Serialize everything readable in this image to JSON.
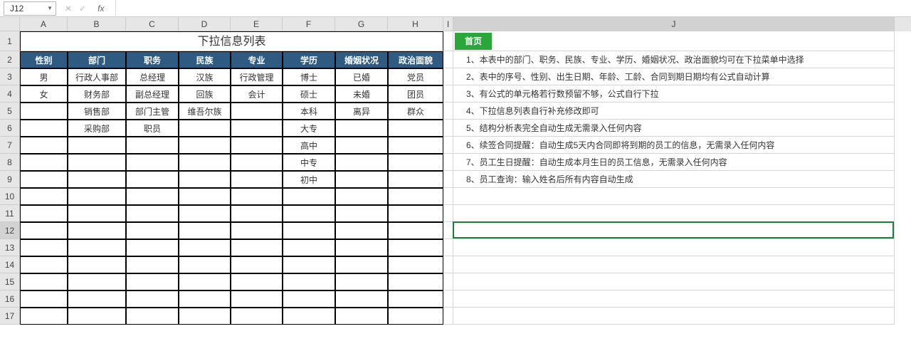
{
  "nameBox": "J12",
  "formula": "",
  "columns": [
    "A",
    "B",
    "C",
    "D",
    "E",
    "F",
    "G",
    "H",
    "I",
    "J"
  ],
  "rowCount": 17,
  "activeCell": {
    "col": "J",
    "row": 12
  },
  "table": {
    "title": "下拉信息列表",
    "headers": [
      "性别",
      "部门",
      "职务",
      "民族",
      "专业",
      "学历",
      "婚姻状况",
      "政治面貌"
    ],
    "rows": [
      [
        "男",
        "行政人事部",
        "总经理",
        "汉族",
        "行政管理",
        "博士",
        "已婚",
        "党员"
      ],
      [
        "女",
        "财务部",
        "副总经理",
        "回族",
        "会计",
        "硕士",
        "未婚",
        "团员"
      ],
      [
        "",
        "销售部",
        "部门主管",
        "维吾尔族",
        "",
        "本科",
        "离异",
        "群众"
      ],
      [
        "",
        "采购部",
        "职员",
        "",
        "",
        "大专",
        "",
        ""
      ],
      [
        "",
        "",
        "",
        "",
        "",
        "高中",
        "",
        ""
      ],
      [
        "",
        "",
        "",
        "",
        "",
        "中专",
        "",
        ""
      ],
      [
        "",
        "",
        "",
        "",
        "",
        "初中",
        "",
        ""
      ]
    ]
  },
  "homeBtn": "首页",
  "notes": [
    "1、本表中的部门、职务、民族、专业、学历、婚姻状况、政治面貌均可在下拉菜单中选择",
    "2、表中的序号、性别、出生日期、年龄、工龄、合同到期日期均有公式自动计算",
    "3、有公式的单元格若行数预留不够，公式自行下拉",
    "4、下拉信息列表自行补充修改即可",
    "5、结构分析表完全自动生成无需录入任何内容",
    "6、续签合同提醒：自动生成5天内合同即将到期的员工的信息，无需录入任何内容",
    "7、员工生日提醒：自动生成本月生日的员工信息，无需录入任何内容",
    "8、员工查询：输入姓名后所有内容自动生成"
  ]
}
